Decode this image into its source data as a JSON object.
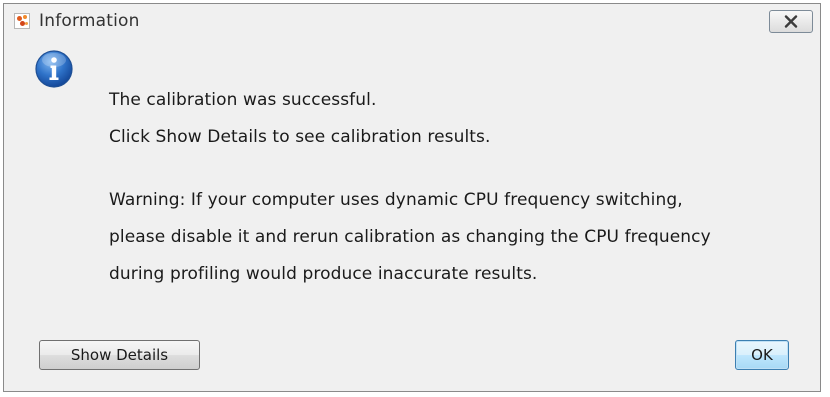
{
  "window": {
    "title": "Information",
    "app_icon": "app-logo-icon",
    "close_icon": "close-icon"
  },
  "message": {
    "icon": "info-icon",
    "lines": [
      "The calibration was successful.",
      "Click Show Details to see calibration results.",
      "Warning: If your computer uses dynamic CPU frequency switching,",
      "please disable it and rerun calibration as changing the CPU frequency",
      "during profiling would produce inaccurate results."
    ]
  },
  "buttons": {
    "details_label": "Show Details",
    "ok_label": "OK"
  },
  "colors": {
    "dialog_background": "#f0f0f0",
    "info_icon_blue": "#1e5fb4",
    "default_button_border": "#3c7fb1"
  }
}
